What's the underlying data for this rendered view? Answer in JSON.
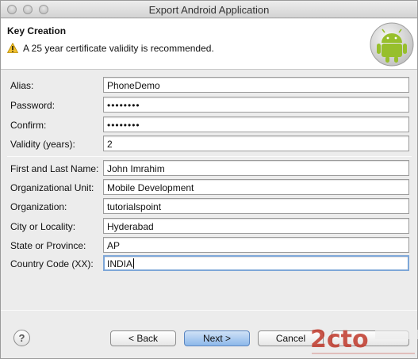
{
  "window": {
    "title": "Export Android Application"
  },
  "header": {
    "title": "Key Creation",
    "message": "A 25 year certificate validity is recommended.",
    "warning_icon": "warning-icon",
    "logo_icon": "android-logo"
  },
  "form": {
    "alias_label": "Alias:",
    "alias_value": "PhoneDemo",
    "password_label": "Password:",
    "password_value": "••••••••",
    "confirm_label": "Confirm:",
    "confirm_value": "••••••••",
    "validity_label": "Validity (years):",
    "validity_value": "2",
    "name_label": "First and Last Name:",
    "name_value": "John Imrahim",
    "org_unit_label": "Organizational Unit:",
    "org_unit_value": "Mobile Development",
    "org_label": "Organization:",
    "org_value": "tutorialspoint",
    "city_label": "City or Locality:",
    "city_value": "Hyderabad",
    "state_label": "State or Province:",
    "state_value": "AP",
    "country_label": "Country Code (XX):",
    "country_value": "INDIA"
  },
  "buttons": {
    "help": "?",
    "back": "< Back",
    "next": "Next >",
    "cancel": "Cancel",
    "finish": ""
  },
  "colors": {
    "accent": "#8db8ea",
    "focus_ring": "#7ea7d8",
    "android_green": "#a4c639"
  }
}
